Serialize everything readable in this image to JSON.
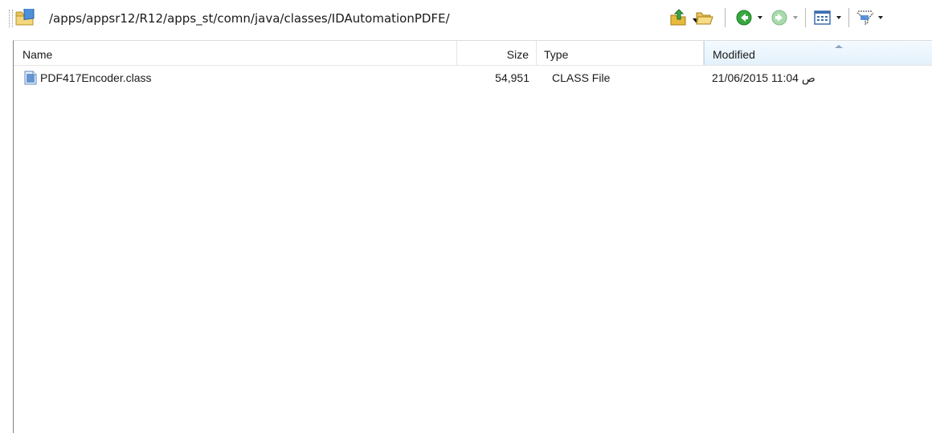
{
  "address": {
    "path": "/apps/appsr12/R12/apps_st/comn/java/classes/IDAutomationPDFE/"
  },
  "toolbar": {
    "icons": [
      "folder-icon",
      "parent-folder-icon",
      "open-folder-icon",
      "back-icon",
      "forward-icon",
      "view-icon",
      "filter-icon"
    ]
  },
  "columns": {
    "name": "Name",
    "size": "Size",
    "type": "Type",
    "modified": "Modified"
  },
  "files": [
    {
      "name": "PDF417Encoder.class",
      "size": "54,951",
      "type": "CLASS File",
      "modified": "21/06/2015 11:04 ص"
    }
  ]
}
